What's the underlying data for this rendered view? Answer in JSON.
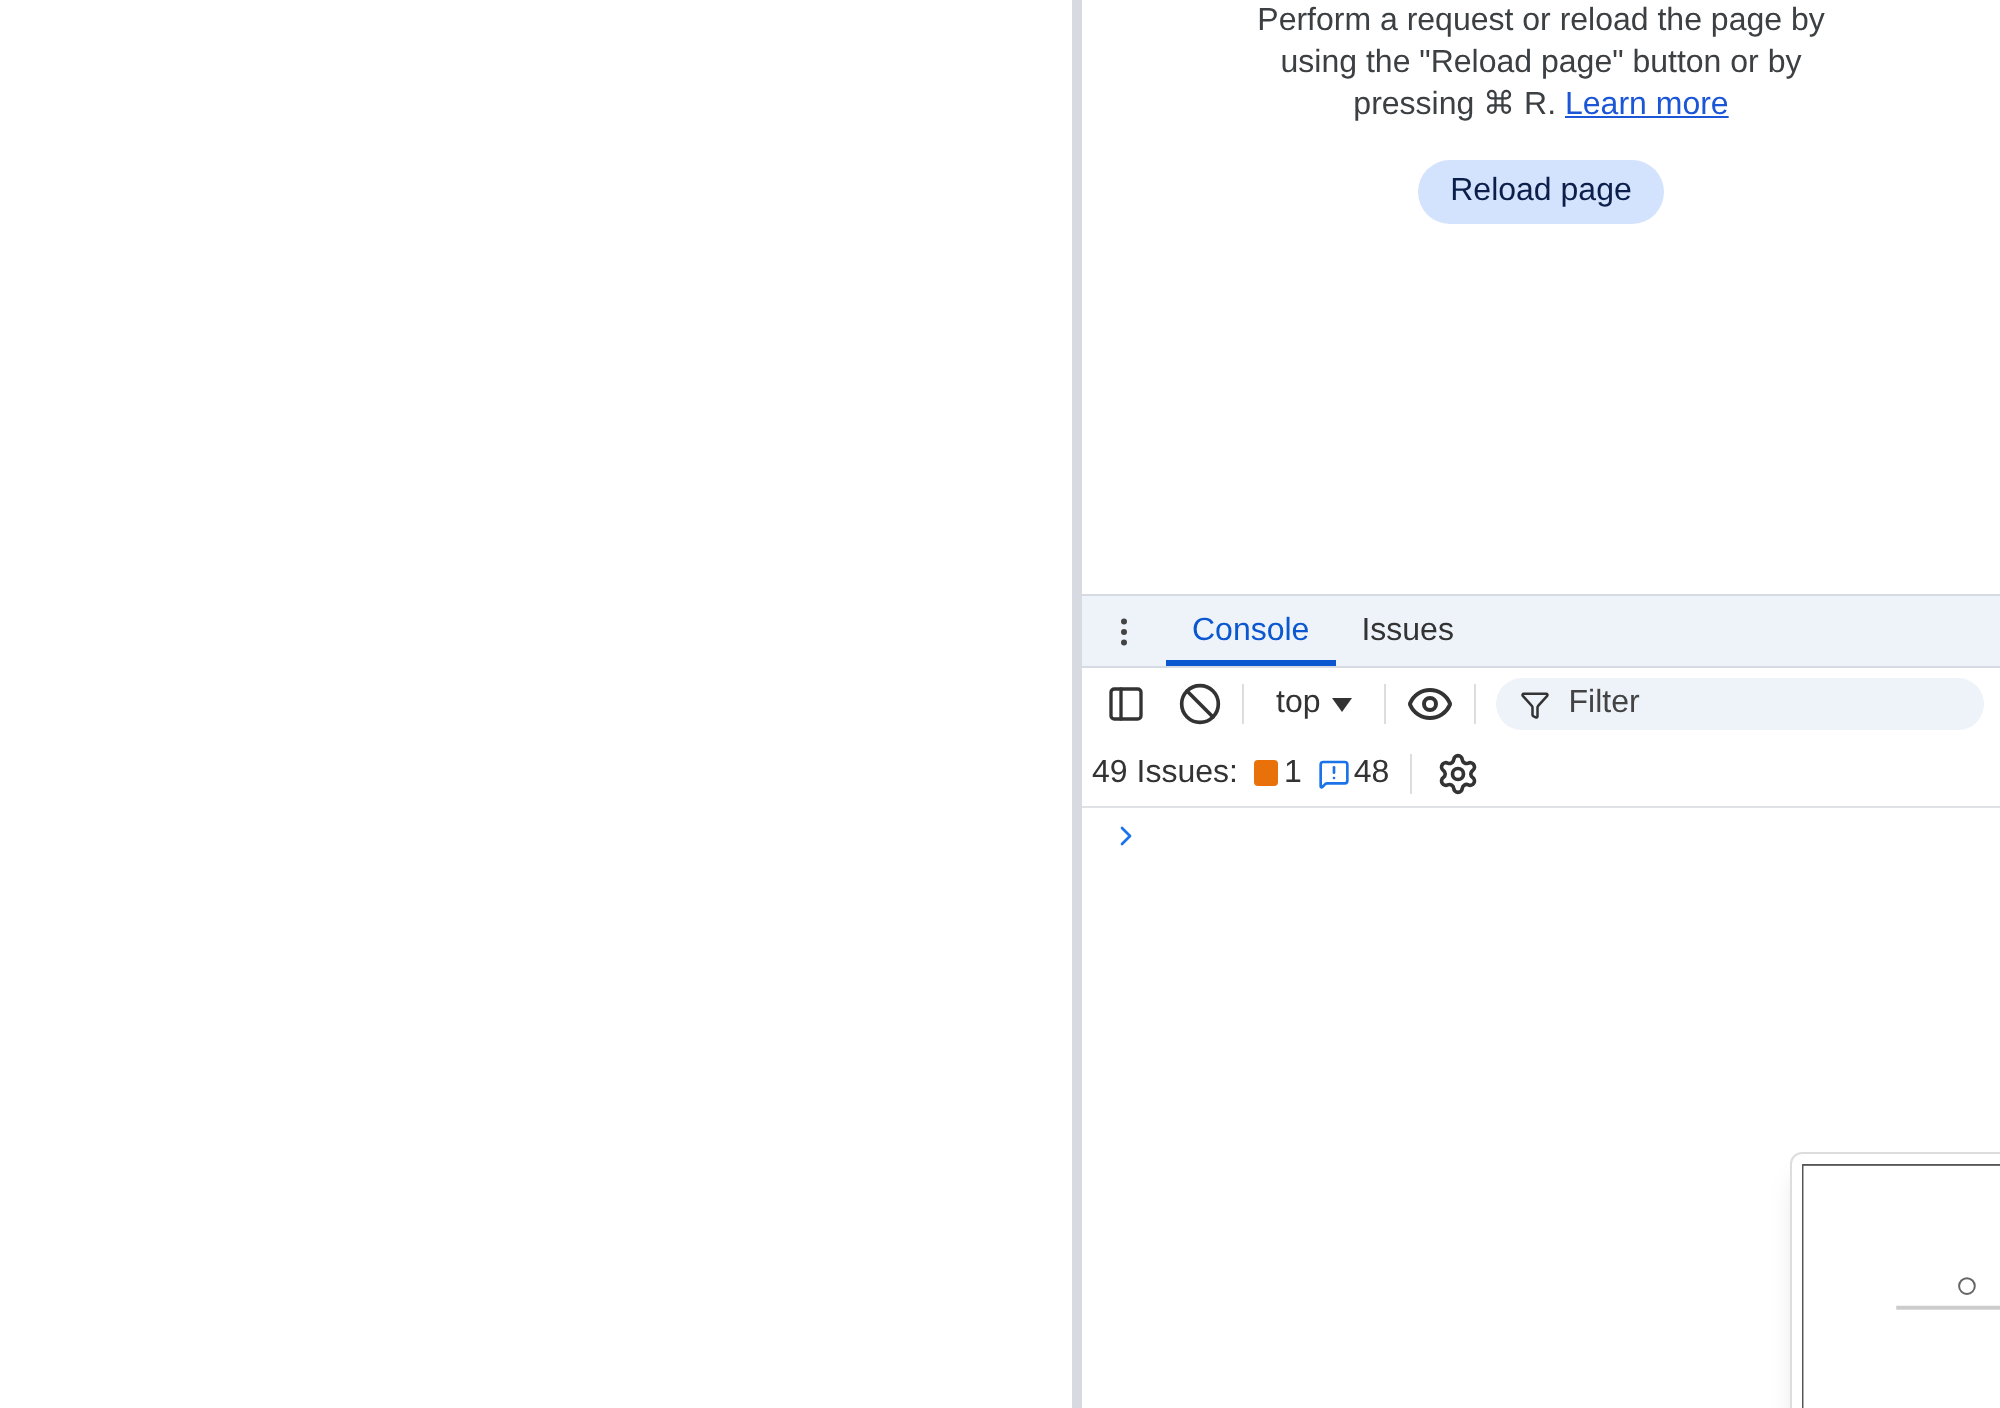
{
  "network_message": {
    "text": "Perform a request or reload the page by using the \"Reload page\" button or by pressing ⌘ R.",
    "link": "Learn more"
  },
  "reload_button": "Reload page",
  "tabs": [
    {
      "label": "Console",
      "selected": true
    },
    {
      "label": "Issues",
      "selected": false
    }
  ],
  "toolbar": {
    "context": "top",
    "filter_placeholder": "Filter"
  },
  "issues": {
    "label": "49 Issues:",
    "errors": "1",
    "info": "48"
  }
}
